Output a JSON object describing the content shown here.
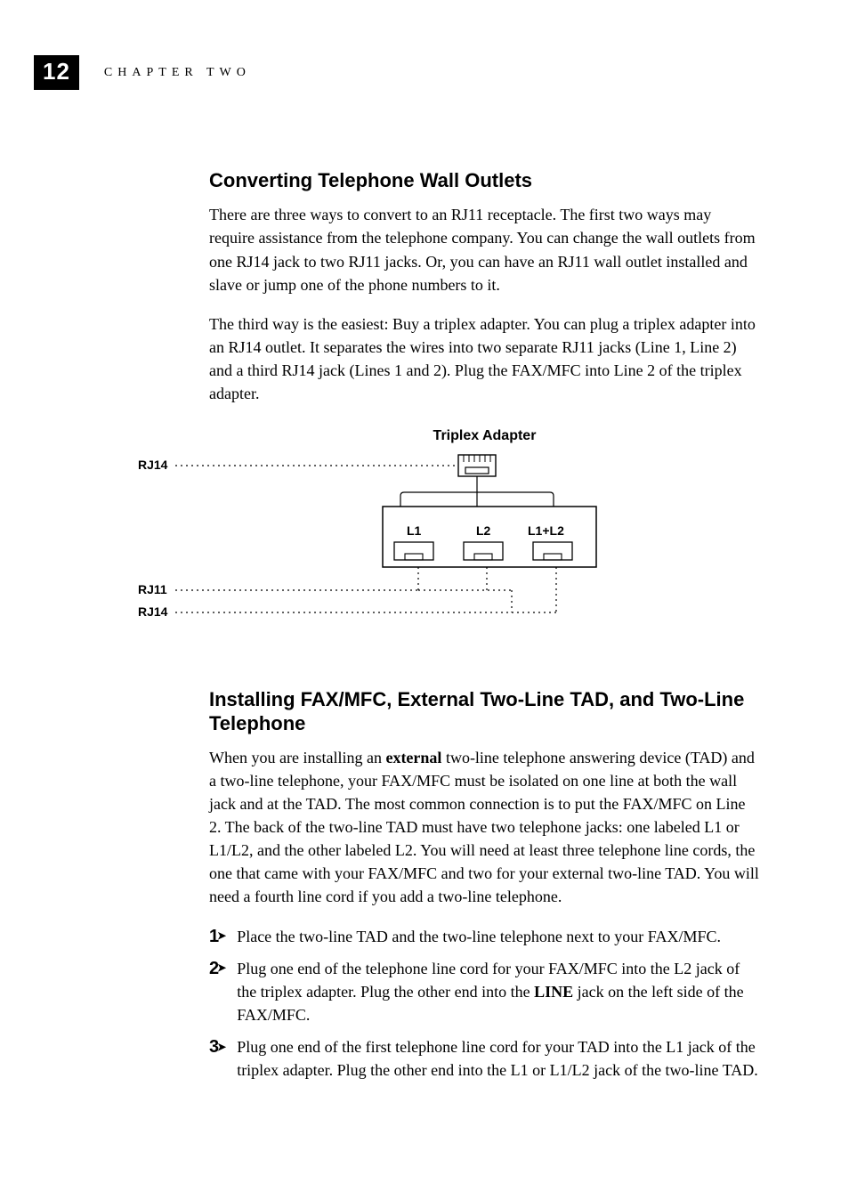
{
  "header": {
    "page_number": "12",
    "chapter_label": "CHAPTER TWO"
  },
  "section1": {
    "heading": "Converting Telephone Wall Outlets",
    "p1": "There are three ways to convert to an RJ11 receptacle. The first two ways may require assistance from the telephone company. You can change the wall outlets from one RJ14 jack to two RJ11 jacks. Or, you can have an RJ11 wall outlet installed and slave or jump one of the phone numbers to it.",
    "p2": "The third way is the easiest: Buy a triplex adapter. You can plug a triplex adapter into an RJ14 outlet. It separates the wires into two separate RJ11 jacks (Line 1, Line 2) and a third RJ14 jack (Lines 1 and 2). Plug the FAX/MFC into Line 2 of the triplex adapter."
  },
  "diagram": {
    "title": "Triplex Adapter",
    "labels": {
      "top": "RJ14",
      "mid": "RJ11",
      "bottom": "RJ14",
      "port1": "L1",
      "port2": "L2",
      "port3": "L1+L2"
    }
  },
  "section2": {
    "heading": "Installing FAX/MFC, External Two-Line TAD, and Two-Line Telephone",
    "p1_pre": "When you are installing an ",
    "p1_bold": "external",
    "p1_post": " two-line telephone answering device (TAD) and a two-line telephone, your FAX/MFC must be isolated on one line at both the wall jack and at the TAD. The most common connection is to put the FAX/MFC on Line 2. The back of the two-line TAD must have two telephone jacks: one labeled L1 or L1/L2, and the other labeled L2. You will need at least three telephone line cords, the one that came with your FAX/MFC and two for your external two-line TAD. You will need a fourth line cord if you add a two-line telephone.",
    "steps": [
      {
        "n": "1",
        "pre": "Place the two-line TAD and the two-line telephone next to your FAX/MFC.",
        "bold": "",
        "post": ""
      },
      {
        "n": "2",
        "pre": "Plug one end of the telephone line cord for your FAX/MFC into the L2 jack of the triplex adapter. Plug the other end into the ",
        "bold": "LINE",
        "post": " jack on the left side of the FAX/MFC."
      },
      {
        "n": "3",
        "pre": "Plug one end of the first telephone line cord for your TAD into the L1 jack of the triplex adapter. Plug the other end into the L1 or L1/L2 jack of the two-line TAD.",
        "bold": "",
        "post": ""
      }
    ]
  }
}
